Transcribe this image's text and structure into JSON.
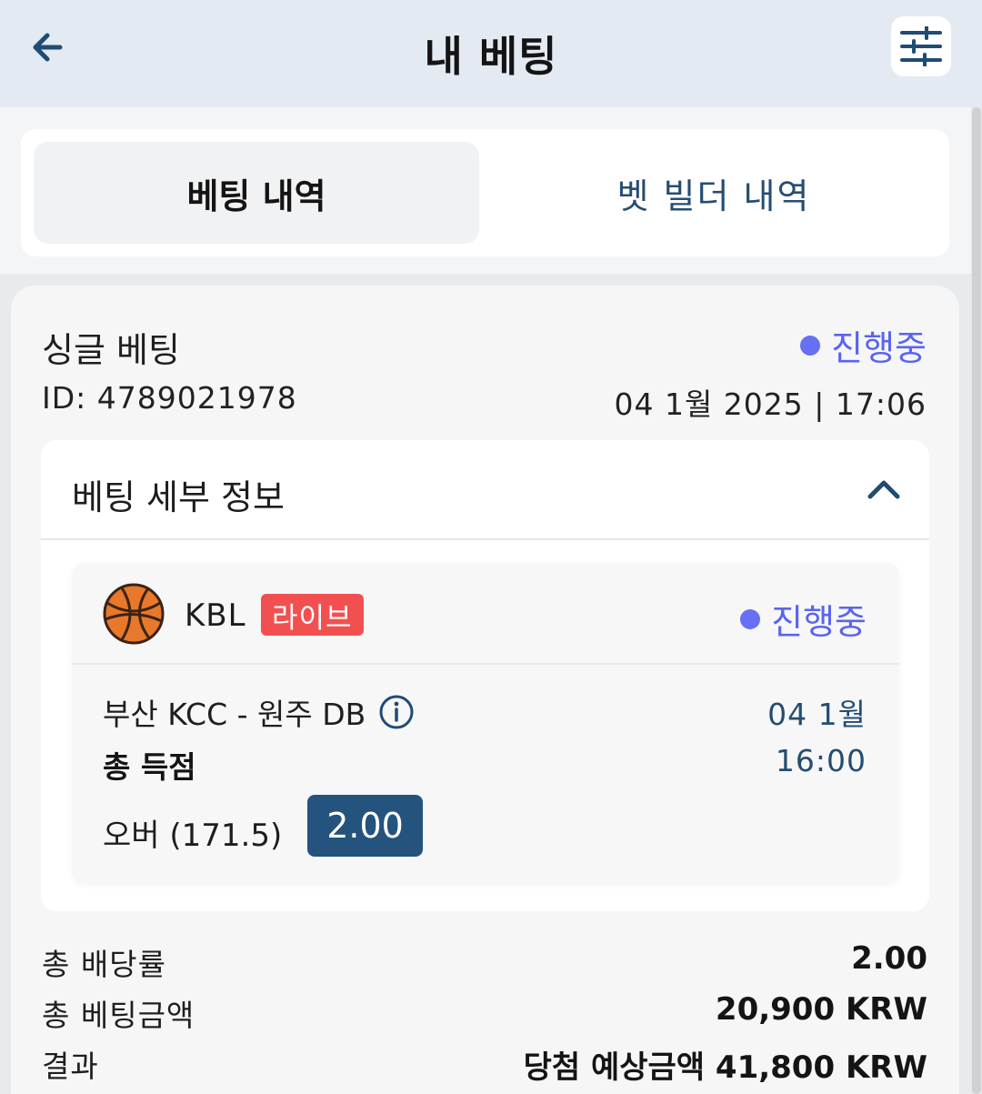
{
  "header": {
    "title": "내 베팅",
    "back_icon": "arrow-left-icon",
    "filter_icon": "sliders-icon"
  },
  "tabs": [
    {
      "label": "베팅 내역",
      "active": true
    },
    {
      "label": "벳 빌더 내역",
      "active": false
    }
  ],
  "bet": {
    "type": "싱글 베팅",
    "status": "진행중",
    "id_text": "ID: 4789021978",
    "datetime": "04 1월 2025 | 17:06",
    "details": {
      "title": "베팅 세부 정보",
      "selection": {
        "league": "KBL",
        "live_badge": "라이브",
        "status": "진행중",
        "match": "부산 KCC - 원주 DB",
        "date": "04 1월",
        "market": "총 득점",
        "time": "16:00",
        "pick": "오버 (171.5)",
        "odds": "2.00"
      }
    },
    "summary": [
      {
        "label": "총 배당률",
        "value": "2.00"
      },
      {
        "label": "총 베팅금액",
        "value": "20,900 KRW"
      },
      {
        "label": "결과",
        "value": "당첨 예상금액 41,800 KRW"
      }
    ]
  },
  "colors": {
    "accent_navy": "#24537d",
    "status_purple": "#6670f5",
    "live_red": "#f25050"
  }
}
